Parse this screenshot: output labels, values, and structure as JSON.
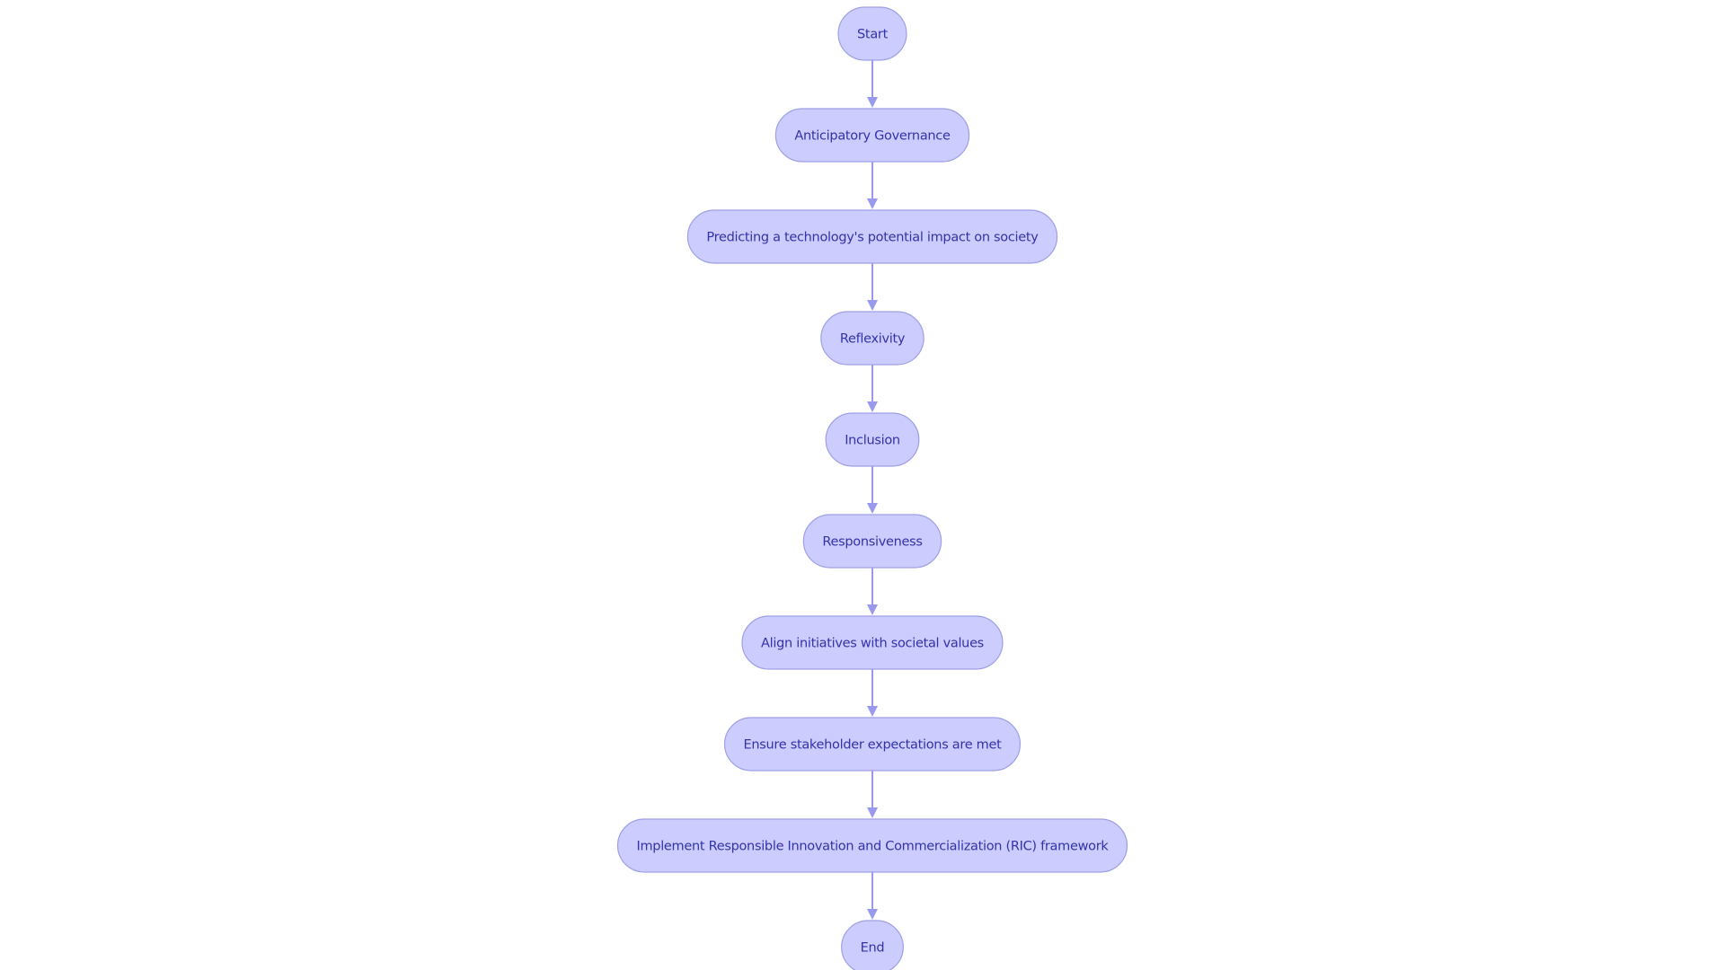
{
  "diagram": {
    "type": "flowchart",
    "direction": "top-to-bottom",
    "colors": {
      "node_fill": "#ccccff",
      "node_border": "#9f9fe6",
      "node_text": "#3333aa",
      "edge": "#9999ee",
      "background": "#ffffff"
    },
    "nodes": [
      {
        "id": "start",
        "label": "Start",
        "shape": "rounded"
      },
      {
        "id": "anticipatory",
        "label": "Anticipatory Governance",
        "shape": "stadium"
      },
      {
        "id": "predicting",
        "label": "Predicting a technology's potential impact on society",
        "shape": "stadium"
      },
      {
        "id": "reflexivity",
        "label": "Reflexivity",
        "shape": "stadium"
      },
      {
        "id": "inclusion",
        "label": "Inclusion",
        "shape": "stadium"
      },
      {
        "id": "responsiveness",
        "label": "Responsiveness",
        "shape": "stadium"
      },
      {
        "id": "align",
        "label": "Align initiatives with societal values",
        "shape": "stadium"
      },
      {
        "id": "ensure",
        "label": "Ensure stakeholder expectations are met",
        "shape": "stadium"
      },
      {
        "id": "implement",
        "label": "Implement Responsible Innovation and Commercialization (RIC) framework",
        "shape": "stadium"
      },
      {
        "id": "end",
        "label": "End",
        "shape": "rounded"
      }
    ],
    "edges": [
      {
        "from": "start",
        "to": "anticipatory"
      },
      {
        "from": "anticipatory",
        "to": "predicting"
      },
      {
        "from": "predicting",
        "to": "reflexivity"
      },
      {
        "from": "reflexivity",
        "to": "inclusion"
      },
      {
        "from": "inclusion",
        "to": "responsiveness"
      },
      {
        "from": "responsiveness",
        "to": "align"
      },
      {
        "from": "align",
        "to": "ensure"
      },
      {
        "from": "ensure",
        "to": "implement"
      },
      {
        "from": "implement",
        "to": "end"
      }
    ]
  }
}
